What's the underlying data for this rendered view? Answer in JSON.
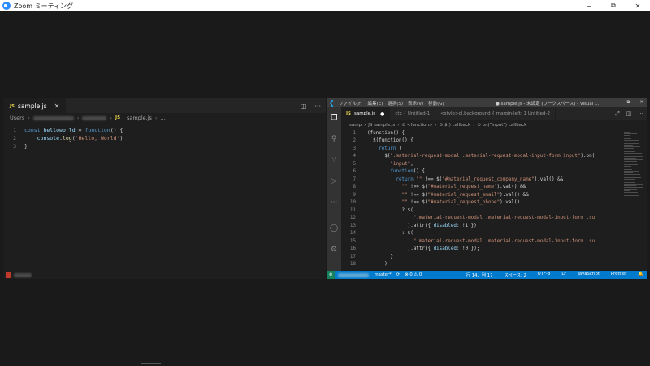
{
  "zoom": {
    "title": "Zoom ミーティング",
    "controls": [
      "−",
      "⧉",
      "✕"
    ]
  },
  "left_editor": {
    "tab": {
      "badge": "JS",
      "label": "sample.js",
      "close": "✕"
    },
    "actions": [
      "◫",
      "···"
    ],
    "breadcrumb": {
      "root": "Users",
      "file": "sample.js",
      "more": "..."
    },
    "lines": [
      {
        "n": "1",
        "tokens": [
          [
            "kw",
            "const "
          ],
          [
            "var",
            "helloworld"
          ],
          [
            "plain",
            " = "
          ],
          [
            "kw",
            "function"
          ],
          [
            "plain",
            "() {"
          ]
        ]
      },
      {
        "n": "2",
        "tokens": [
          [
            "plain",
            "    "
          ],
          [
            "var",
            "console"
          ],
          [
            "plain",
            "."
          ],
          [
            "fn",
            "log"
          ],
          [
            "plain",
            "("
          ],
          [
            "str",
            "'Hello, World'"
          ],
          [
            "plain",
            ")"
          ]
        ]
      },
      {
        "n": "3",
        "tokens": [
          [
            "plain",
            "}"
          ]
        ]
      }
    ]
  },
  "right_editor": {
    "menu": [
      "ファイル(F)",
      "編集(E)",
      "選択(S)",
      "表示(V)",
      "移動(G)"
    ],
    "window_title": "● sample.js - 未設定 (ワークスペース) - Visual ...",
    "window_controls": [
      "−",
      "⧉",
      "✕"
    ],
    "tabs": [
      {
        "label": "sample.js",
        "dirty": "●"
      },
      {
        "label": "ctx { Untitled-1"
      },
      {
        "label": "<style>ol.background { margin-left: 1 Untitled-2"
      }
    ],
    "tab_actions": [
      "⤢",
      "◫",
      "···"
    ],
    "breadcrumb": [
      "samp",
      "›",
      "JS sample.js",
      "›",
      "⊙ <function>",
      "›",
      "⊙ $() callback",
      "›",
      "⊙ on(\"input\") callback"
    ],
    "lines": [
      {
        "n": "1",
        "tokens": [
          [
            "plain",
            "(function() {"
          ]
        ]
      },
      {
        "n": "2",
        "tokens": [
          [
            "plain",
            "  $(function() {"
          ]
        ]
      },
      {
        "n": "3",
        "tokens": [
          [
            "plain",
            "    "
          ],
          [
            "kw",
            "return"
          ],
          [
            "plain",
            " ("
          ]
        ]
      },
      {
        "n": "4",
        "tokens": [
          [
            "plain",
            "      $("
          ],
          [
            "str",
            "\".material-request-modal .material-request-modal-input-form input\""
          ],
          [
            "plain",
            ").on("
          ]
        ]
      },
      {
        "n": "5",
        "tokens": [
          [
            "plain",
            "        "
          ],
          [
            "str",
            "\"input\""
          ],
          [
            "plain",
            ","
          ]
        ]
      },
      {
        "n": "6",
        "tokens": [
          [
            "plain",
            "        "
          ],
          [
            "kw",
            "function"
          ],
          [
            "plain",
            "() {"
          ]
        ]
      },
      {
        "n": "7",
        "tokens": [
          [
            "plain",
            "          "
          ],
          [
            "kw",
            "return"
          ],
          [
            "plain",
            " "
          ],
          [
            "str",
            "\"\""
          ],
          [
            "plain",
            " !== $("
          ],
          [
            "str",
            "\"#material_request_company_name\""
          ],
          [
            "plain",
            ").val() &&"
          ]
        ]
      },
      {
        "n": "8",
        "tokens": [
          [
            "plain",
            "            "
          ],
          [
            "str",
            "\"\""
          ],
          [
            "plain",
            " !== $("
          ],
          [
            "str",
            "\"#material_request_name\""
          ],
          [
            "plain",
            ").val() &&"
          ]
        ]
      },
      {
        "n": "9",
        "tokens": [
          [
            "plain",
            "            "
          ],
          [
            "str",
            "\"\""
          ],
          [
            "plain",
            " !== $("
          ],
          [
            "str",
            "\"#material_request_email\""
          ],
          [
            "plain",
            ").val() &&"
          ]
        ]
      },
      {
        "n": "10",
        "tokens": [
          [
            "plain",
            "            "
          ],
          [
            "str",
            "\"\""
          ],
          [
            "plain",
            " !== $("
          ],
          [
            "str",
            "\"#material_request_phone\""
          ],
          [
            "plain",
            ").val()"
          ]
        ]
      },
      {
        "n": "11",
        "tokens": [
          [
            "plain",
            "            ? $("
          ]
        ]
      },
      {
        "n": "12",
        "tokens": [
          [
            "plain",
            "                "
          ],
          [
            "str",
            "\".material-request-modal .material-request-modal-input-form .su"
          ]
        ]
      },
      {
        "n": "13",
        "tokens": [
          [
            "plain",
            "              ).attr({ "
          ],
          [
            "var",
            "disabled"
          ],
          [
            "plain",
            ": !1 })"
          ]
        ]
      },
      {
        "n": "14",
        "tokens": [
          [
            "plain",
            "            : $("
          ]
        ]
      },
      {
        "n": "15",
        "tokens": [
          [
            "plain",
            "                "
          ],
          [
            "str",
            "\".material-request-modal .material-request-modal-input-form .su"
          ]
        ]
      },
      {
        "n": "16",
        "tokens": [
          [
            "plain",
            "              ).attr({ "
          ],
          [
            "var",
            "disabled"
          ],
          [
            "plain",
            ": !0 });"
          ]
        ]
      },
      {
        "n": "17",
        "tokens": [
          [
            "plain",
            "        }"
          ]
        ]
      },
      {
        "n": "18",
        "tokens": [
          [
            "plain",
            "      )"
          ]
        ]
      }
    ],
    "status": {
      "remote": "⊗",
      "branch": "master*",
      "sync": "⟳",
      "problems": "⊗ 0 ⚠ 0",
      "position": "行 14、列 17",
      "spaces": "スペース: 2",
      "encoding": "UTF-8",
      "eol": "LF",
      "language": "JavaScript",
      "formatter": "Prettier",
      "bell": "🔔"
    }
  },
  "colors": {
    "accent": "#007acc",
    "zoom_blue": "#2d8cff"
  }
}
